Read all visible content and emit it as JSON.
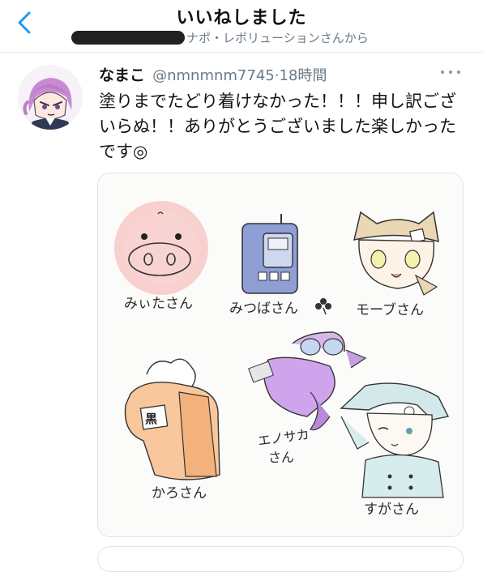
{
  "header": {
    "title": "いいねしました",
    "subtitle": "ナポ・レボリューションさんから"
  },
  "tweet": {
    "display_name": "なまこ",
    "handle": "@nmnmnm7745",
    "separator": "·",
    "time": "18時間",
    "text": "塗りまでたどり着けなかった！！！申し訳ございらぬ！！ありがとうございました楽しかったです◎",
    "media": {
      "labels": {
        "miita": "みぃたさん",
        "mitsuba": "みつばさん",
        "mobu": "モーブさん",
        "karo": "かろさん",
        "enosaka_line1": "エノサカ",
        "enosaka_line2": "さん",
        "suga": "すがさん"
      },
      "sign_text": "黒"
    }
  },
  "colors": {
    "accent": "#1d9bf0",
    "secondary_text": "#6b7a87",
    "divider": "#e4e8eb"
  },
  "icons": {
    "back": "chevron-left-icon",
    "more": "more-horizontal-icon"
  }
}
